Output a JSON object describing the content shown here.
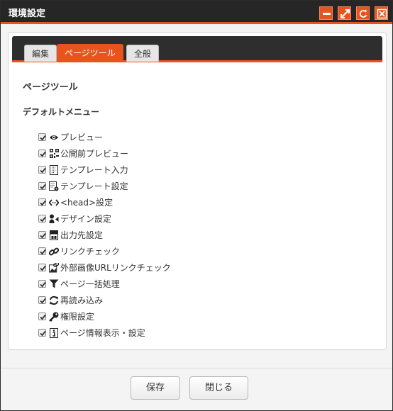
{
  "window": {
    "title": "環境設定",
    "accent_color": "#e8541e",
    "titlebar_buttons": [
      "minimize-icon",
      "expand-icon",
      "refresh-icon",
      "close-icon"
    ]
  },
  "tabs": [
    {
      "label": "編集",
      "active": false
    },
    {
      "label": "ページツール",
      "active": true
    },
    {
      "label": "全般",
      "active": false
    }
  ],
  "content": {
    "section_title": "ページツール",
    "subsection_title": "デフォルトメニュー",
    "menu_items": [
      {
        "label": "プレビュー",
        "icon": "eye-icon",
        "checked": true
      },
      {
        "label": "公開前プレビュー",
        "icon": "qr-code-icon",
        "checked": true
      },
      {
        "label": "テンプレート入力",
        "icon": "template-document-icon",
        "checked": true
      },
      {
        "label": "テンプレート設定",
        "icon": "template-settings-icon",
        "checked": true
      },
      {
        "label": "<head>設定",
        "icon": "code-arrows-icon",
        "checked": true
      },
      {
        "label": "デザイン設定",
        "icon": "design-icon",
        "checked": true
      },
      {
        "label": "出力先設定",
        "icon": "output-icon",
        "checked": true
      },
      {
        "label": "リンクチェック",
        "icon": "link-icon",
        "checked": true
      },
      {
        "label": "外部画像URLリンクチェック",
        "icon": "image-link-icon",
        "checked": true
      },
      {
        "label": "ページ一括処理",
        "icon": "filter-icon",
        "checked": true
      },
      {
        "label": "再読み込み",
        "icon": "reload-icon",
        "checked": true
      },
      {
        "label": "権限設定",
        "icon": "key-icon",
        "checked": true
      },
      {
        "label": "ページ情報表示・設定",
        "icon": "info-document-icon",
        "checked": true
      }
    ]
  },
  "footer": {
    "save_label": "保存",
    "close_label": "閉じる"
  }
}
